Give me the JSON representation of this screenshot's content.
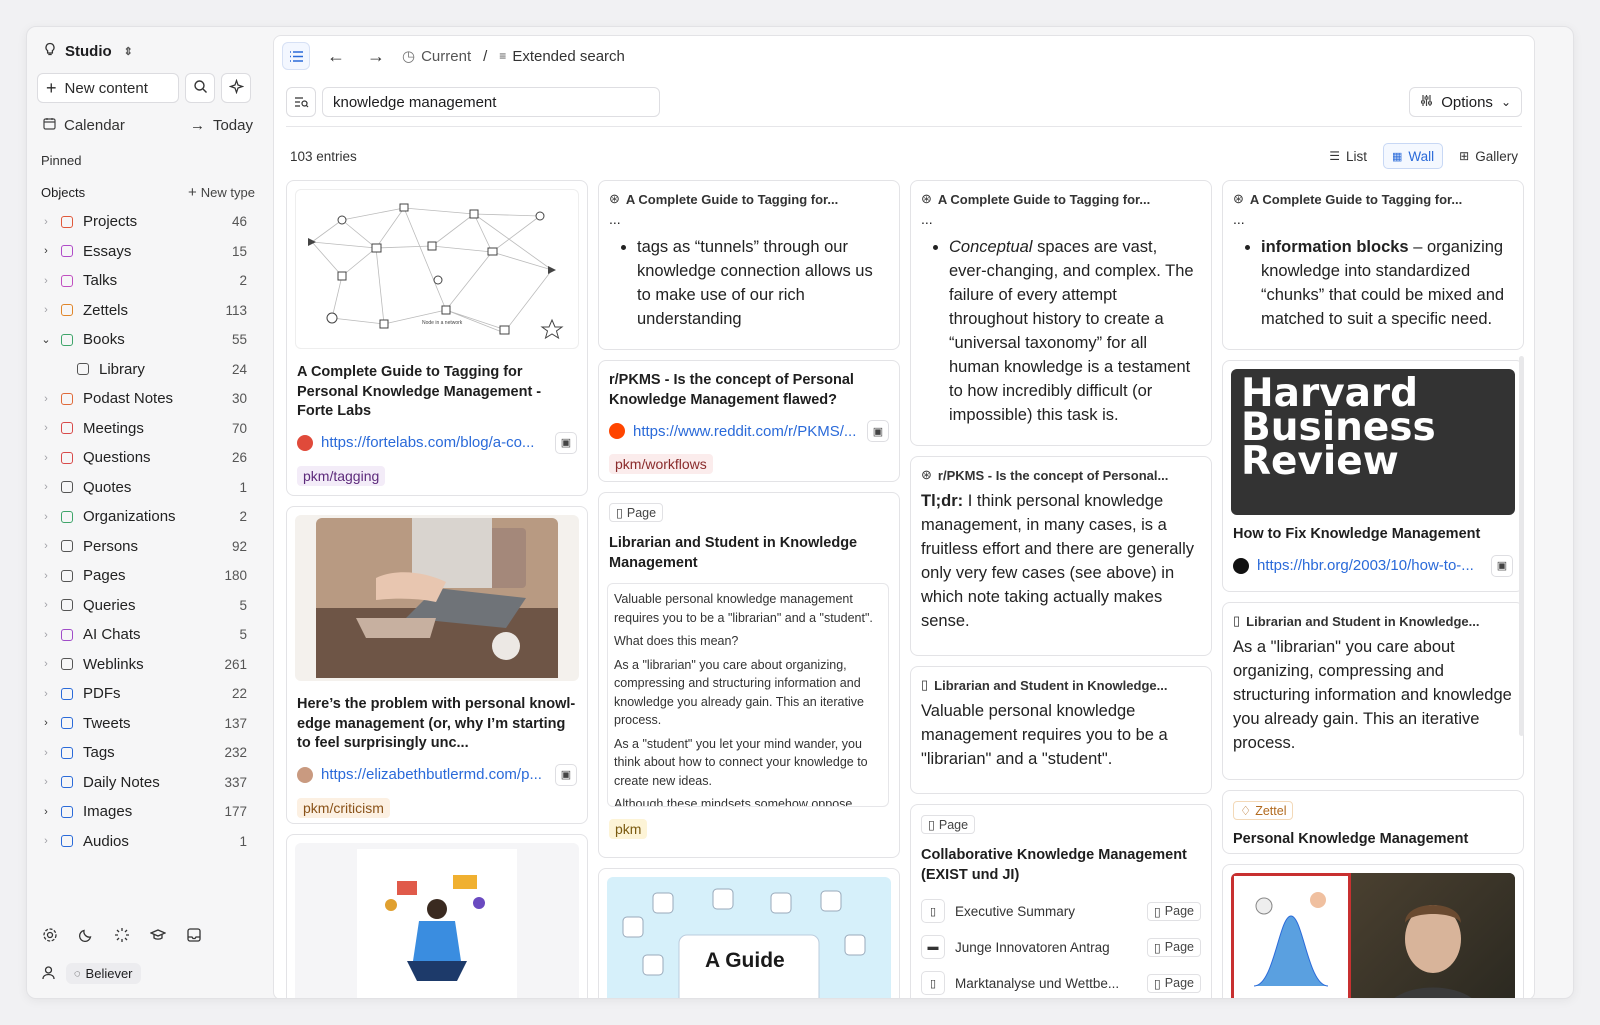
{
  "workspace": {
    "name": "Studio"
  },
  "sidebar": {
    "new_content": "New content",
    "calendar": "Calendar",
    "today": "Today",
    "pinned": "Pinned",
    "objects": "Objects",
    "new_type": "New type",
    "items": [
      {
        "label": "Projects",
        "count": "46",
        "icon": "cube-icon",
        "color": "#e0583a",
        "chev": "›"
      },
      {
        "label": "Essays",
        "count": "15",
        "icon": "pen-icon",
        "color": "#b04cc8",
        "chev": "›"
      },
      {
        "label": "Talks",
        "count": "2",
        "icon": "speech-icon",
        "color": "#c04fc0",
        "chev": "›"
      },
      {
        "label": "Zettels",
        "count": "113",
        "icon": "bulb-icon",
        "color": "#e0862a",
        "chev": "›"
      },
      {
        "label": "Books",
        "count": "55",
        "icon": "book-icon",
        "color": "#3fa56a",
        "chev": "⌄"
      },
      {
        "label": "Library",
        "count": "24",
        "icon": "library-icon",
        "color": "#555",
        "chev": ""
      },
      {
        "label": "Podast Notes",
        "count": "30",
        "icon": "mic-icon",
        "color": "#e06a3a",
        "chev": "›"
      },
      {
        "label": "Meetings",
        "count": "70",
        "icon": "calendar-icon",
        "color": "#d84a4a",
        "chev": "›"
      },
      {
        "label": "Questions",
        "count": "26",
        "icon": "question-icon",
        "color": "#d84a4a",
        "chev": "›"
      },
      {
        "label": "Quotes",
        "count": "1",
        "icon": "quote-icon",
        "color": "#555",
        "chev": "›"
      },
      {
        "label": "Organizations",
        "count": "2",
        "icon": "building-icon",
        "color": "#3fa56a",
        "chev": "›"
      },
      {
        "label": "Persons",
        "count": "92",
        "icon": "person-icon",
        "color": "#555",
        "chev": "›"
      },
      {
        "label": "Pages",
        "count": "180",
        "icon": "page-icon",
        "color": "#555",
        "chev": "›"
      },
      {
        "label": "Queries",
        "count": "5",
        "icon": "query-icon",
        "color": "#555",
        "chev": "›"
      },
      {
        "label": "AI Chats",
        "count": "5",
        "icon": "chat-icon",
        "color": "#a04cc8",
        "chev": "›"
      },
      {
        "label": "Weblinks",
        "count": "261",
        "icon": "globe-icon",
        "color": "#555",
        "chev": "›"
      },
      {
        "label": "PDFs",
        "count": "22",
        "icon": "pdf-icon",
        "color": "#2a6ad9",
        "chev": "›"
      },
      {
        "label": "Tweets",
        "count": "137",
        "icon": "bird-icon",
        "color": "#2a6ad9",
        "chev": "›"
      },
      {
        "label": "Tags",
        "count": "232",
        "icon": "tag-icon",
        "color": "#2a6ad9",
        "chev": "›"
      },
      {
        "label": "Daily Notes",
        "count": "337",
        "icon": "daily-icon",
        "color": "#2a6ad9",
        "chev": "›"
      },
      {
        "label": "Images",
        "count": "177",
        "icon": "image-icon",
        "color": "#2a6ad9",
        "chev": "›"
      },
      {
        "label": "Audios",
        "count": "1",
        "icon": "audio-icon",
        "color": "#2a6ad9",
        "chev": "›"
      }
    ],
    "user": "Believer"
  },
  "topbar": {
    "current": "Current",
    "separator": "/",
    "page": "Extended search"
  },
  "search": {
    "query": "knowledge management",
    "options": "Options"
  },
  "results": {
    "count_label": "103 entries",
    "views": [
      "List",
      "Wall",
      "Gallery"
    ],
    "active_view": "Wall"
  },
  "cards": {
    "c1": {
      "title": "A Complete Guide to Tagging for Personal Knowledge Management - Forte Labs",
      "url": "https://fortelabs.com/blog/a-co...",
      "tag": "pkm/tagging",
      "diagram_caption": "Node in a network"
    },
    "c2": {
      "title": "Here’s the problem with personal knowl-edge management (or, why I’m starting to feel surprisingly unc...",
      "url": "https://elizabethbutlermd.com/p...",
      "tag": "pkm/criticism"
    },
    "d1": {
      "header": "A Complete Guide to Tagging for...",
      "dots": "...",
      "bullet": "tags as “tunnels” through our knowledge connection allows us to make use of our rich understanding"
    },
    "d2": {
      "title": "r/PKMS - Is the concept of Personal Knowledge Management flawed?",
      "url": "https://www.reddit.com/r/PKMS/...",
      "tag": "pkm/workflows"
    },
    "d3": {
      "chip": "Page",
      "title": "Librarian and Student in Knowledge Management",
      "paras": [
        "Valuable personal knowledge management requires you to be a \"librarian\" and a \"student\".",
        "What does this mean?",
        "As a \"librarian\" you care about organizing, compressing and structuring information and knowledge you already gain. This an iterative process.",
        "As a \"student\" you let your mind wander, you think about how to connect your knowledge to create new ideas.",
        "Although these mindsets somehow oppose each other, it's important to master both and"
      ],
      "tag": "pkm"
    },
    "d4": {
      "title": "A Guide"
    },
    "e1": {
      "header": "A Complete Guide to Tagging for...",
      "dots": "...",
      "em": "Conceptual",
      "bullet": " spaces are vast, ever-changing, and complex. The failure of every attempt throughout history to create a “universal taxonomy” for all human knowledge is a testament to how incredibly difficult (or impossible) this task is."
    },
    "e2": {
      "header": "r/PKMS - Is the concept of Personal...",
      "bold": "Tl;dr:",
      "text": " I think personal knowledge management, in many cases, is a fruitless effort and there are generally only very few cases (see above) in which note taking actually makes sense."
    },
    "e3": {
      "header": "Librarian and Student in Knowledge...",
      "text": "Valuable personal knowledge management requires you to be a \"librarian\" and a \"student\"."
    },
    "e4": {
      "chip": "Page",
      "title": "Collaborative Knowledge Management (EXIST und JI)",
      "rows": [
        {
          "label": "Executive Summary",
          "chip": "Page"
        },
        {
          "label": "Junge Innovatoren Antrag",
          "chip": "Page"
        },
        {
          "label": "Marktanalyse und Wettbe...",
          "chip": "Page"
        }
      ]
    },
    "f1": {
      "header": "A Complete Guide to Tagging for...",
      "dots": "...",
      "bold": "information blocks",
      "bullet": " – organizing knowledge into standardized “chunks” that could be mixed and matched to suit a specific need."
    },
    "f2": {
      "logo_lines": [
        "Harvard",
        "Business",
        "Review"
      ],
      "title": "How to Fix Knowledge Management",
      "url": "https://hbr.org/2003/10/how-to-..."
    },
    "f3": {
      "header": "Librarian and Student in Knowledge...",
      "text": "As a \"librarian\" you care about organizing, compressing and structuring information and knowledge you already gain. This an iterative process."
    },
    "f4": {
      "chip": "Zettel",
      "title": "Personal Knowledge Management"
    }
  }
}
